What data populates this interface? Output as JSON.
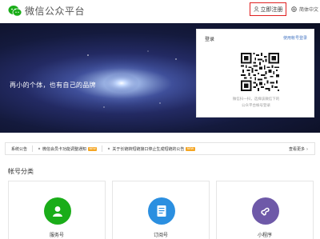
{
  "header": {
    "logo_text": "微信公众平台",
    "register_label": "立即注册",
    "language_label": "简体中文"
  },
  "banner": {
    "slogan": "再小的个体，也有自己的品牌"
  },
  "login": {
    "title": "登录",
    "alt_login": "使用帐号登录",
    "hint_line1": "微信扫一扫，选择该微信下的",
    "hint_line2": "公众平台帐号登录"
  },
  "notice": {
    "label": "系统公告",
    "items": [
      {
        "text": "微信会员卡功能调整通知",
        "badge": "NEW"
      },
      {
        "text": "关于长链转短链接口停止生成短链的公告",
        "badge": "NEW"
      }
    ],
    "more_label": "查看更多"
  },
  "accounts": {
    "title": "帐号分类",
    "cards": [
      {
        "label": "服务号",
        "icon": "person-icon",
        "color": "#1aad19"
      },
      {
        "label": "订阅号",
        "icon": "document-icon",
        "color": "#2b8fe0"
      },
      {
        "label": "小程序",
        "icon": "miniprogram-icon",
        "color": "#6e59a8"
      }
    ]
  },
  "colors": {
    "brand_green": "#1aad19",
    "highlight_red": "#e02020",
    "link_blue": "#4a79c4"
  }
}
